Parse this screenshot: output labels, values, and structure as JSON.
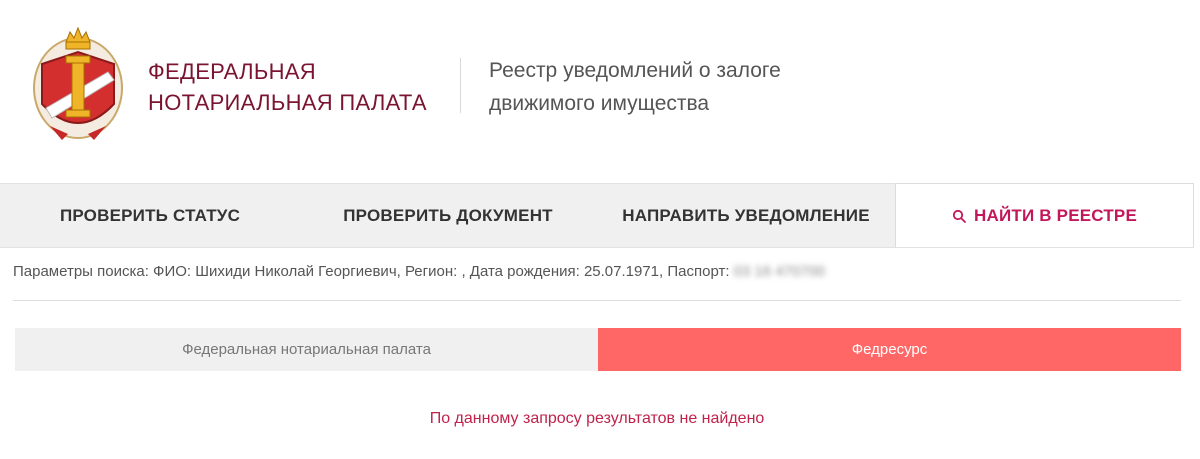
{
  "header": {
    "org_name_line1": "ФЕДЕРАЛЬНАЯ",
    "org_name_line2": "НОТАРИАЛЬНАЯ ПАЛАТА",
    "registry_title_line1": "Реестр уведомлений о залоге",
    "registry_title_line2": "движимого имущества",
    "emblem_icon": "notary-emblem-icon"
  },
  "tabs": [
    {
      "label": "ПРОВЕРИТЬ СТАТУС",
      "active": false
    },
    {
      "label": "ПРОВЕРИТЬ ДОКУМЕНТ",
      "active": false
    },
    {
      "label": "НАПРАВИТЬ УВЕДОМЛЕНИЕ",
      "active": false
    },
    {
      "label": "НАЙТИ В РЕЕСТРЕ",
      "active": true,
      "icon": "search-icon"
    }
  ],
  "search_params": {
    "text": "Параметры поиска: ФИО: Шихиди Николай Георгиевич, Регион: , Дата рождения: 25.07.1971, Паспорт:",
    "passport_value": "03 16 470700"
  },
  "sources": {
    "tab1": "Федеральная нотариальная палата",
    "tab2": "Федресурс",
    "active": "tab2"
  },
  "result_message": "По данному запросу результатов не найдено",
  "colors": {
    "brand": "#7a1430",
    "accent": "#c2185b",
    "active_source": "#ff6666",
    "tab_bg": "#f0f0f0"
  }
}
